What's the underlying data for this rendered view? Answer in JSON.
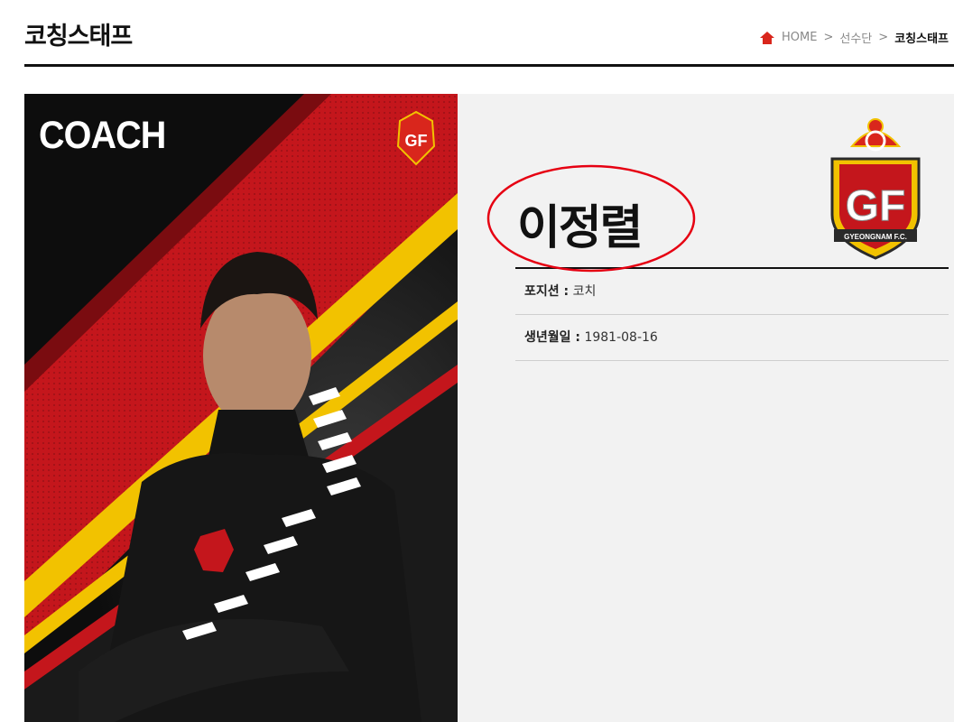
{
  "header": {
    "title": "코칭스태프"
  },
  "breadcrumb": {
    "home": "HOME",
    "separator": ">",
    "section": "선수단",
    "current": "코칭스태프"
  },
  "photo": {
    "label": "COACH"
  },
  "player": {
    "name": "이정렬",
    "fields": [
      {
        "key": "포지션 :",
        "value": "코치"
      },
      {
        "key": "생년월일 :",
        "value": "1981-08-16"
      }
    ]
  },
  "logo": {
    "text": "GYEONGNAM F.C."
  },
  "colors": {
    "accent_red": "#d9261c",
    "brand_red": "#c4161c",
    "brand_yellow": "#f2c200",
    "dark": "#111111",
    "annotation_red": "#e60012"
  },
  "icons": {
    "breadcrumb_home": "home-icon"
  }
}
